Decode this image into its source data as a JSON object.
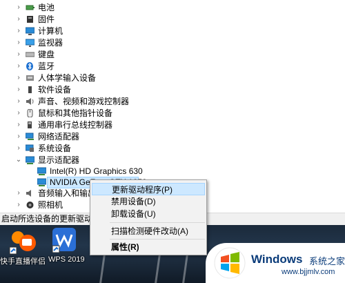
{
  "tree": {
    "items": [
      {
        "label": "电池",
        "icon": "battery-icon"
      },
      {
        "label": "固件",
        "icon": "firmware-icon"
      },
      {
        "label": "计算机",
        "icon": "computer-icon"
      },
      {
        "label": "监视器",
        "icon": "monitor-icon"
      },
      {
        "label": "键盘",
        "icon": "keyboard-icon"
      },
      {
        "label": "蓝牙",
        "icon": "bluetooth-icon"
      },
      {
        "label": "人体学输入设备",
        "icon": "hid-icon"
      },
      {
        "label": "软件设备",
        "icon": "software-device-icon"
      },
      {
        "label": "声音、视频和游戏控制器",
        "icon": "speaker-icon"
      },
      {
        "label": "鼠标和其他指针设备",
        "icon": "mouse-icon"
      },
      {
        "label": "通用串行总线控制器",
        "icon": "usb-icon"
      },
      {
        "label": "网络适配器",
        "icon": "network-adapter-icon"
      },
      {
        "label": "系统设备",
        "icon": "system-device-icon"
      },
      {
        "label": "显示适配器",
        "icon": "display-adapter-icon"
      }
    ],
    "display_children": [
      {
        "label": "Intel(R) HD Graphics 630",
        "icon": "display-adapter-icon"
      },
      {
        "label": "NVIDIA GeFo... GTX 1050",
        "icon": "display-adapter-icon"
      }
    ],
    "after_items": [
      {
        "label": "音频输入和输出",
        "icon": "audio-icon"
      },
      {
        "label": "照相机",
        "icon": "camera-icon"
      }
    ]
  },
  "status_bar": {
    "text": "启动所选设备的更新驱动程序"
  },
  "context_menu": {
    "items": [
      {
        "label": "更新驱动程序(P)"
      },
      {
        "label": "禁用设备(D)"
      },
      {
        "label": "卸载设备(U)"
      },
      {
        "label": "扫描检测硬件改动(A)"
      },
      {
        "label": "属性(R)"
      }
    ]
  },
  "desktop": {
    "icons": [
      {
        "label": "快手直播伴侣",
        "icon": "kuaishou-icon"
      },
      {
        "label": "WPS 2019",
        "icon": "wps-icon"
      }
    ]
  },
  "watermark": {
    "brand": "Windows",
    "cn": "系统之家",
    "url": "www.bjjmlv.com"
  },
  "colors": {
    "selection": "#cce8ff",
    "menu_highlight": "#cde8ff",
    "wps_blue": "#2b6fd6",
    "windows_blue": "#0b6ad8"
  }
}
